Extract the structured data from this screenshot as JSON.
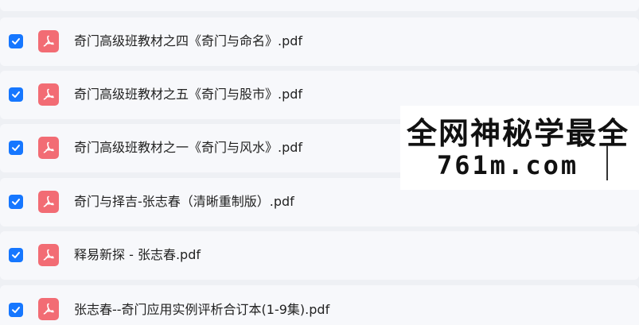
{
  "files": [
    {
      "name": "奇门高级班教材之四《奇门与命名》.pdf",
      "checked": true
    },
    {
      "name": "奇门高级班教材之五《奇门与股市》.pdf",
      "checked": true
    },
    {
      "name": "奇门高级班教材之一《奇门与风水》.pdf",
      "checked": true
    },
    {
      "name": "奇门与择吉-张志春（清晰重制版）.pdf",
      "checked": true
    },
    {
      "name": "释易新探 - 张志春.pdf",
      "checked": true
    },
    {
      "name": "张志春--奇门应用实例评析合订本(1-9集).pdf",
      "checked": true
    }
  ],
  "watermark": {
    "line1": "全网神秘学最全",
    "line2": "761m.com"
  },
  "colors": {
    "checkbox": "#1677ff",
    "pdf_icon": "#f26c74",
    "row_background": "#f7f8fb",
    "page_background": "#eef0f4"
  },
  "icons": {
    "checkbox": "checkmark-icon",
    "file": "pdf-file-icon"
  }
}
